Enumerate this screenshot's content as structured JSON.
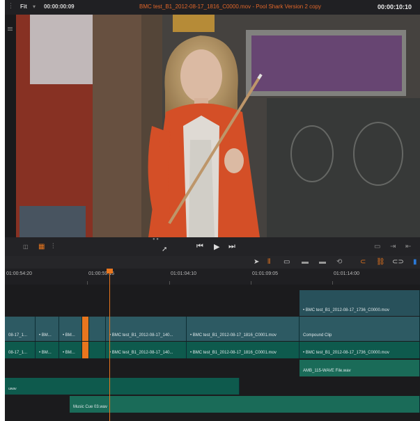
{
  "viewer": {
    "fit_label": "Fit",
    "timecode_left": "00:00:00:09",
    "title": "BMC test_B1_2012-08-17_1816_C0000.mov - Pool Shark Version 2 copy",
    "timecode_right": "00:00:10:10"
  },
  "transport": {
    "prev_label": "⏮",
    "play_label": "▶",
    "next_label": "⏭"
  },
  "ruler": {
    "tc1": "01:00:54:20",
    "tc2": "01:00:59:15",
    "tc3": "01:01:04:10",
    "tc4": "01:01:09:05",
    "tc5": "01:01:14:00"
  },
  "clips": {
    "v3_right": "• BMC test_B1_2012-08-17_1736_C0000.mov",
    "v2_a": "08-17_1...",
    "v2_b": "• BM...",
    "v2_c": "• BM...",
    "v2_d": "• BMC test_B1_2012-08-17_140...",
    "v2_e": "• BMC test_B1_2012-08-17_1816_C0001.mov",
    "v2_f": "Compound Clip",
    "v1_a": "08-17_1...",
    "v1_b": "• BM...",
    "v1_c": "• BM...",
    "v1_d": "• BMC test_B1_2012-08-17_140...",
    "v1_e": "• BMC test_B1_2012-08-17_1816_C0001.mov",
    "v1_f": "• BMC test_B1_2012-08-17_1736_C0000.mov",
    "a1_right": "AMB_115-WAVE File.wav",
    "a2_left": "uwav",
    "a3_music": "Music Cue 03.wav"
  },
  "colors": {
    "accent": "#e8761e",
    "video_clip": "#28515b",
    "audio_clip": "#0e5a4d"
  }
}
